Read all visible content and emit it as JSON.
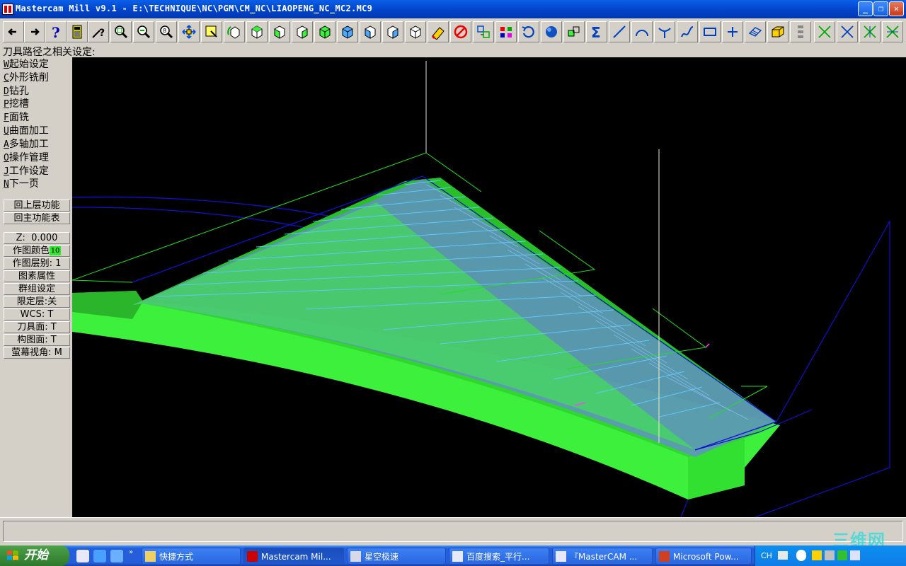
{
  "window": {
    "title": "Mastercam Mill v9.1 - E:\\TECHNIQUE\\NC\\PGM\\CM_NC\\LIAOPENG_NC_MC2.MC9",
    "minimize": "_",
    "restore": "❐",
    "close": "✕"
  },
  "toolbar": {
    "icons": [
      "back-arrow-icon",
      "forward-arrow-icon",
      "help-icon",
      "calculator-icon",
      "analyze-icon",
      "zoom-window-icon",
      "zoom-out-icon",
      "zoom-previous-icon",
      "pan-icon",
      "select-icon",
      "rotate-view-icon",
      "top-view-icon",
      "front-view-icon",
      "side-view-icon",
      "iso-view-icon",
      "cube-view-1-icon",
      "cube-view-2-icon",
      "cube-view-3-icon",
      "cube-view-4-icon",
      "eraser-icon",
      "delete-icon",
      "translate-icon",
      "mirror-icon",
      "undo-icon",
      "sphere-icon",
      "group-icon",
      "sigma-icon",
      "line-icon",
      "arc-icon",
      "fillet-icon",
      "spline-icon",
      "rectangle-icon",
      "point-icon",
      "surface-icon",
      "solid-icon",
      "levels-icon",
      "trim-icon",
      "break-icon",
      "join-icon",
      "modify-icon"
    ]
  },
  "prompt": "刀具路径之相关设定:",
  "menu": {
    "items": [
      {
        "key": "W",
        "label": "起始设定"
      },
      {
        "key": "C",
        "label": "外形铣削"
      },
      {
        "key": "D",
        "label": "钻孔"
      },
      {
        "key": "P",
        "label": "挖槽"
      },
      {
        "key": "F",
        "label": "面铣"
      },
      {
        "key": "U",
        "label": "曲面加工"
      },
      {
        "key": "A",
        "label": "多轴加工"
      },
      {
        "key": "O",
        "label": "操作管理"
      },
      {
        "key": "J",
        "label": "工作设定"
      },
      {
        "key": "N",
        "label": "下一页"
      }
    ],
    "back_label": "回上层功能",
    "main_label": "回主功能表",
    "z_label": "Z:",
    "z_value": "0.000",
    "color_label": "作图颜色",
    "color_value": "10",
    "level_label": "作图层别: 1",
    "attrib_label": "图素属性",
    "group_label": "群组设定",
    "mask_label": "限定层:关",
    "wcs_label": "WCS: T",
    "tplane_label": "刀具面: T",
    "cplane_label": "构图面: T",
    "gview_label": "萤幕视角: M"
  },
  "viewport": {
    "background": "#000000",
    "part_color": "#3cf03c",
    "toolpath_color": "#5fc8ff",
    "boundary_color": "#1010d0"
  },
  "taskbar": {
    "start_label": "开始",
    "tasks": [
      {
        "label": "快捷方式",
        "icon": "folder-icon"
      },
      {
        "label": "Mastercam Mil...",
        "icon": "mastercam-icon"
      },
      {
        "label": "星空极速",
        "icon": "network-icon"
      },
      {
        "label": "百度搜索_平行...",
        "icon": "ie-icon"
      },
      {
        "label": "『MasterCAM ...",
        "icon": "ie-icon"
      },
      {
        "label": "Microsoft Pow...",
        "icon": "powerpoint-icon"
      }
    ],
    "tray_lang": "CH"
  },
  "watermark": "三维网"
}
